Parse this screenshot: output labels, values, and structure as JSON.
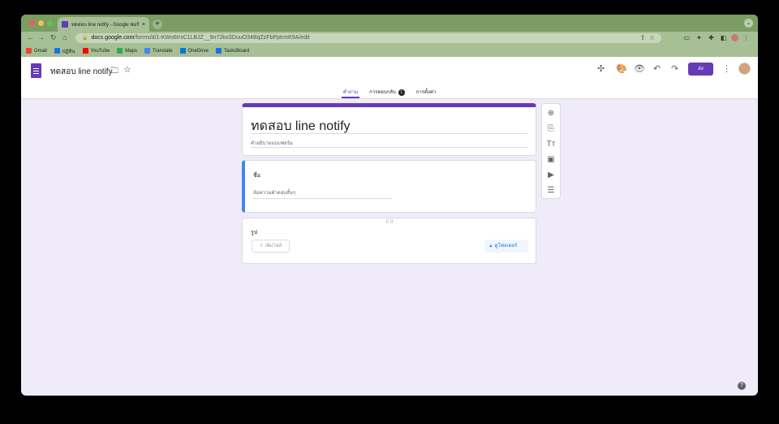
{
  "browser": {
    "tab_title": "ทดสอบ line notify - Google ฟอร์ม",
    "tab_close": "×",
    "new_tab": "+",
    "tab_menu": "⌄",
    "url_host": "docs.google.com",
    "url_path": "/forms/d/1-KWo6IrxC1LBJZ__9n72kxSDuuO34BqZzFbPptrmK9A/edit",
    "bookmarks": [
      {
        "label": "Gmail",
        "color": "#ea4335"
      },
      {
        "label": "ปฏิทิน",
        "color": "#1a73e8"
      },
      {
        "label": "YouTube",
        "color": "#ff0000"
      },
      {
        "label": "Maps",
        "color": "#34a853"
      },
      {
        "label": "Translate",
        "color": "#4285f4"
      },
      {
        "label": "OneDrive",
        "color": "#0078d4"
      },
      {
        "label": "TasksBoard",
        "color": "#1a73e8"
      }
    ]
  },
  "forms": {
    "doc_title": "ทดสอบ line notify",
    "send_label": "ส่ง",
    "tabs": [
      {
        "label": "คำถาม",
        "active": true
      },
      {
        "label": "การตอบกลับ",
        "badge": "1"
      },
      {
        "label": "การตั้งค่า"
      }
    ],
    "accent": "#673ab7"
  },
  "form": {
    "title": "ทดสอบ line notify",
    "description": "คำอธิบายแบบฟอร์ม",
    "q1": {
      "title": "ชื่อ",
      "answer_placeholder": "ข้อความคำตอบสั้นๆ"
    },
    "q2": {
      "title": "รูป",
      "add_file": "เพิ่มไฟล์",
      "view_folder": "ดูโฟลเดอร์",
      "drag_handle": "⠿⠿"
    }
  },
  "help": "?"
}
